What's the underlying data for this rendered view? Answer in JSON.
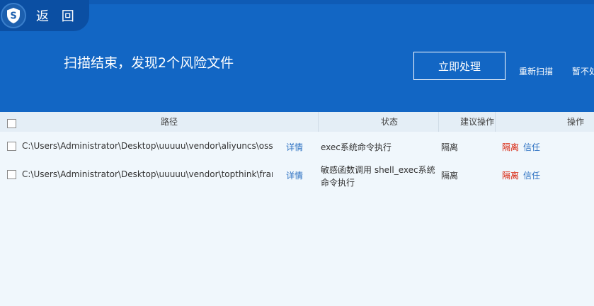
{
  "header": {
    "back_label": "返 回",
    "result_title": "扫描结束，发现2个风险文件",
    "process_button": "立即处理",
    "rescan_link": "重新扫描",
    "skip_link": "暂不处理"
  },
  "table": {
    "columns": {
      "path": "路径",
      "status": "状态",
      "suggestion": "建议操作",
      "action": "操作"
    },
    "rows": [
      {
        "path": "C:\\Users\\Administrator\\Desktop\\uuuuu\\vendor\\aliyuncs\\oss-sdk-php\\src",
        "detail": "详情",
        "status_line1": "exec系统命令执行",
        "status_line2": "",
        "suggestion": "隔离",
        "quarantine": "隔离",
        "trust": "信任"
      },
      {
        "path": "C:\\Users\\Administrator\\Desktop\\uuuuu\\vendor\\topthink\\framework\\src",
        "detail": "详情",
        "status_line1": "敏感函数调用   shell_exec系统",
        "status_line2": "命令执行",
        "suggestion": "隔离",
        "quarantine": "隔离",
        "trust": "信任"
      }
    ]
  },
  "colors": {
    "header_bg": "#1266c4",
    "back_tab_bg": "#0b4fa3",
    "table_bg": "#f0f7fc",
    "link": "#2a6fc1",
    "danger": "#d81e06"
  }
}
